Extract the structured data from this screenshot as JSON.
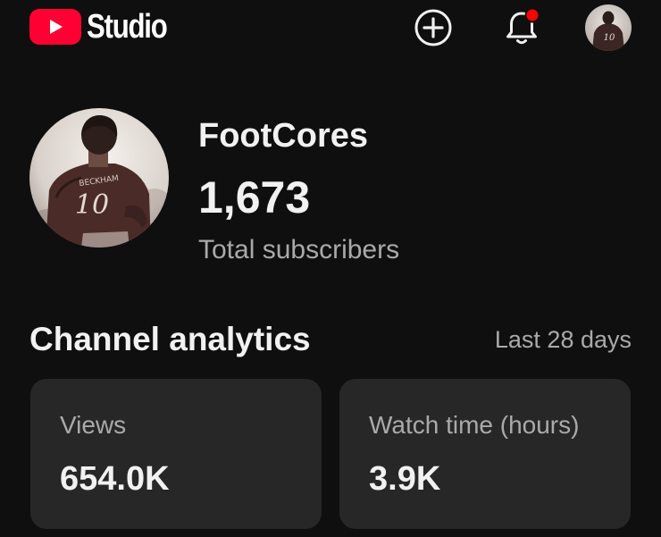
{
  "app": {
    "logo_text": "Studio",
    "brand_color": "#ff0033"
  },
  "topbar": {
    "create_icon": "add-circle-icon",
    "notifications_icon": "bell-icon",
    "notification_dot_color": "#ff0000",
    "account_icon": "account-avatar"
  },
  "channel": {
    "name": "FootCores",
    "subscriber_count": "1,673",
    "subscriber_label": "Total subscribers"
  },
  "analytics": {
    "title": "Channel analytics",
    "period": "Last 28 days",
    "cards": [
      {
        "label": "Views",
        "value": "654.0K"
      },
      {
        "label": "Watch time (hours)",
        "value": "3.9K"
      }
    ]
  }
}
